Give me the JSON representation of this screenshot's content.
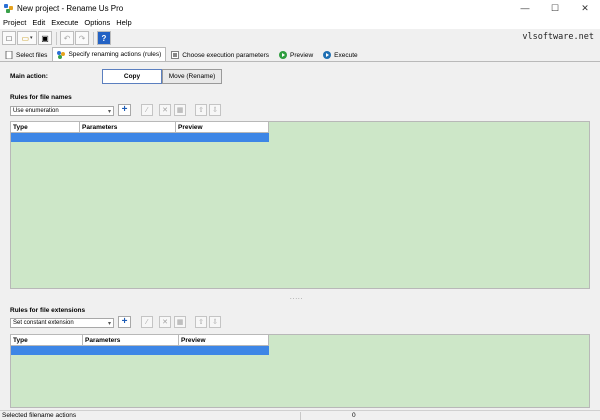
{
  "window": {
    "title": "New project - Rename Us Pro",
    "controls": {
      "minimize": "—",
      "maximize": "☐",
      "close": "✕"
    }
  },
  "menu": [
    "Project",
    "Edit",
    "Execute",
    "Options",
    "Help"
  ],
  "toolbar": {
    "buttons": [
      {
        "name": "new-icon",
        "glyph": "□"
      },
      {
        "name": "open-icon",
        "glyph": "▭"
      },
      {
        "name": "save-icon",
        "glyph": "▣"
      },
      {
        "name": "undo-icon",
        "glyph": "↶"
      },
      {
        "name": "redo-icon",
        "glyph": "↷"
      },
      {
        "name": "help-icon",
        "glyph": "?"
      }
    ],
    "brand": "vlsoftware.net"
  },
  "tabs": [
    {
      "label": "Select files",
      "icon": "files-icon"
    },
    {
      "label": "Specify renaming actions (rules)",
      "icon": "rules-icon",
      "active": true
    },
    {
      "label": "Choose execution parameters",
      "icon": "params-icon"
    },
    {
      "label": "Preview",
      "icon": "preview-icon"
    },
    {
      "label": "Execute",
      "icon": "execute-icon"
    }
  ],
  "main_action": {
    "label": "Main action:",
    "options": [
      "Copy",
      "Move (Rename)"
    ],
    "selected": "Copy"
  },
  "names_section": {
    "label": "Rules for file names",
    "select_value": "Use enumeration",
    "columns": [
      "Type",
      "Parameters",
      "Preview"
    ]
  },
  "extensions_section": {
    "label": "Rules for file extensions",
    "select_value": "Set constant extension",
    "columns": [
      "Type",
      "Parameters",
      "Preview"
    ]
  },
  "splitter": ".....",
  "status": {
    "label": "Selected filename actions",
    "count": "0"
  },
  "colors": {
    "grid_background": "#cde7c8",
    "selected_row": "#3d86e6",
    "add_button": "#1f5db5"
  }
}
